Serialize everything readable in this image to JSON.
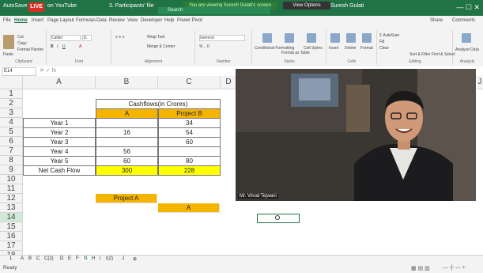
{
  "titlebar": {
    "autosave": "AutoSave",
    "live": "LIVE",
    "stream": "on YouTube",
    "doc": "3. Participants' file",
    "share_banner": "You are viewing Suresh Gulati's screen",
    "view_options": "View Options",
    "search": "Search",
    "user": "Suresh Gulati"
  },
  "menu": [
    "File",
    "Home",
    "Insert",
    "Page Layout",
    "Formulas",
    "Data",
    "Review",
    "View",
    "Developer",
    "Help",
    "Power Pivot"
  ],
  "menu_share": "Share",
  "menu_comments": "Comments",
  "ribbon": {
    "clipboard": "Clipboard",
    "paste": "Paste",
    "cut": "Cut",
    "copy": "Copy",
    "format_painter": "Format Painter",
    "font": "Font",
    "font_name": "Calibri",
    "font_size": "11",
    "alignment": "Alignment",
    "wrap_text": "Wrap Text",
    "merge_center": "Merge & Center",
    "number": "Number",
    "number_format": "General",
    "styles": "Styles",
    "conditional_formatting": "Conditional Formatting",
    "format_as_table": "Format as Table",
    "cell_styles": "Cell Styles",
    "cells": "Cells",
    "insert": "Insert",
    "delete": "Delete",
    "format": "Format",
    "editing": "Editing",
    "autosum": "AutoSum",
    "fill": "Fill",
    "clear": "Clear",
    "sort_filter": "Sort & Filter",
    "find_select": "Find & Select",
    "analysis": "Analysis",
    "analyze_data": "Analyze Data"
  },
  "formula": {
    "namebox": "E14"
  },
  "columns": [
    "A",
    "B",
    "C",
    "D",
    "E",
    "F",
    "G",
    "H",
    "I",
    "J"
  ],
  "rows": [
    "1",
    "2",
    "3",
    "4",
    "5",
    "6",
    "7",
    "8",
    "9",
    "10",
    "11",
    "12",
    "13",
    "14",
    "15",
    "16",
    "17",
    "18"
  ],
  "table": {
    "header": "Cashflows(in Crores)",
    "project_a": "A",
    "project_b": "Project B",
    "years": [
      "Year 1",
      "Year 2",
      "Year 3",
      "Year 4",
      "Year 5"
    ],
    "a_values": [
      "",
      "16",
      "",
      "56",
      "60"
    ],
    "b_values": [
      "34",
      "54",
      "60",
      "",
      "80"
    ],
    "net_label": "Net Cash Flow",
    "net_a": "300",
    "net_b": "228",
    "project_a_label": "Project A",
    "a_marker": "A"
  },
  "video": {
    "name": "Mr. Vinod Tejwani"
  },
  "sheet_tabs": [
    "1",
    "A",
    "B",
    "C",
    "C(2)",
    "D",
    "E",
    "F",
    "G",
    "H",
    "I",
    "I(2)",
    "J"
  ],
  "active_sheet": "G",
  "status": "Ready",
  "colors": {
    "orange": "#f5b400",
    "yellow": "#ffff00",
    "brand": "#217346"
  }
}
